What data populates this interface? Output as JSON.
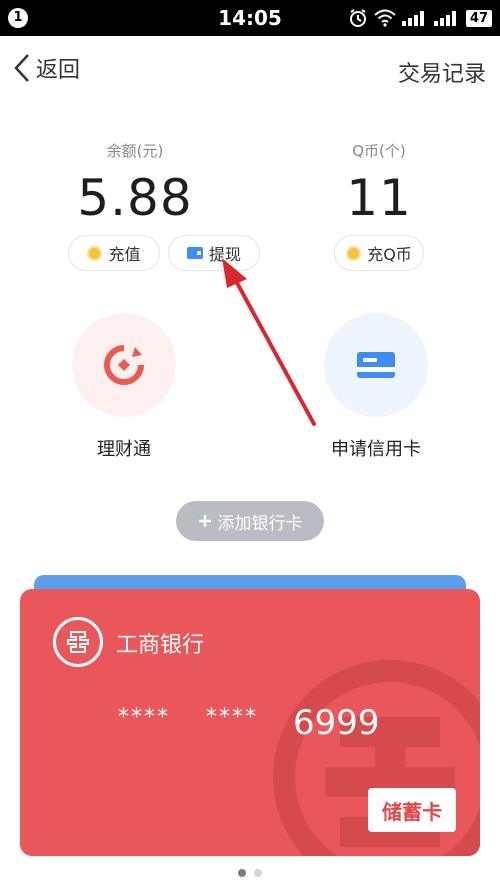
{
  "status_bar": {
    "notification_count": "1",
    "time": "14:05",
    "battery": "47"
  },
  "nav": {
    "back_label": "返回",
    "records_label": "交易记录"
  },
  "balance": {
    "label": "余额(元)",
    "value": "5.88"
  },
  "qcoin": {
    "label": "Q币(个)",
    "value": "11"
  },
  "actions": {
    "recharge": "充值",
    "withdraw": "提现",
    "recharge_qcoin": "充Q币"
  },
  "services": {
    "licaitong": "理财通",
    "credit_card": "申请信用卡"
  },
  "add_card": {
    "label": "添加银行卡"
  },
  "bank_card": {
    "bank_name": "工商银行",
    "mask_1": "****",
    "mask_2": "****",
    "last4": "6999",
    "card_type": "储蓄卡"
  },
  "pager": {
    "total": 2,
    "active": 1
  },
  "colors": {
    "card_red": "#ea575a",
    "card_blue": "#5b9ee9",
    "annotation_arrow": "#d9272e"
  },
  "icons": [
    "signal-icon",
    "alarm-icon",
    "wifi-icon",
    "battery-icon",
    "chevron-left-icon",
    "coin-icon",
    "wallet-icon",
    "licaitong-icon",
    "credit-card-icon",
    "plus-icon",
    "icbc-logo-icon"
  ]
}
